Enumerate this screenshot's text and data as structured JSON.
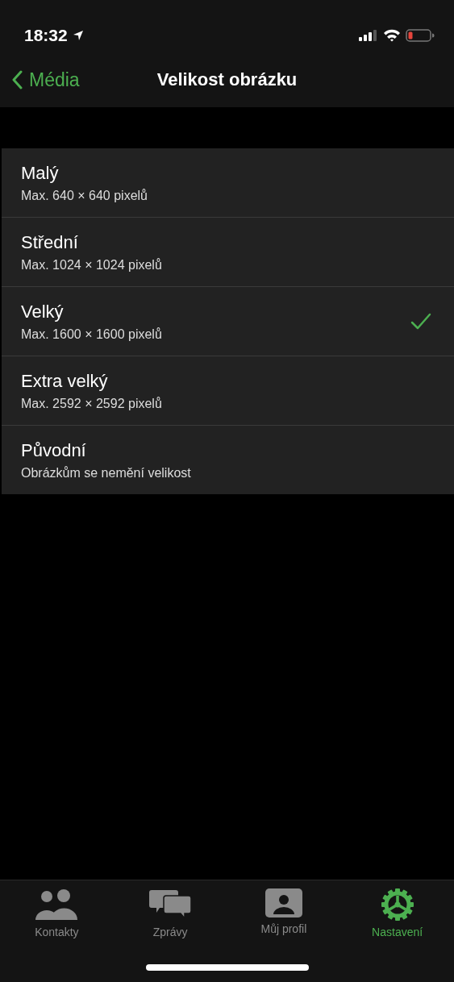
{
  "status_bar": {
    "time": "18:32"
  },
  "nav": {
    "back": "Média",
    "title": "Velikost obrázku"
  },
  "options": [
    {
      "title": "Malý",
      "subtitle": "Max. 640 × 640 pixelů",
      "selected": false
    },
    {
      "title": "Střední",
      "subtitle": "Max. 1024 × 1024 pixelů",
      "selected": false
    },
    {
      "title": "Velký",
      "subtitle": "Max. 1600 × 1600 pixelů",
      "selected": true
    },
    {
      "title": "Extra velký",
      "subtitle": "Max. 2592 × 2592 pixelů",
      "selected": false
    },
    {
      "title": "Původní",
      "subtitle": "Obrázkům se nemění velikost",
      "selected": false
    }
  ],
  "tabs": [
    {
      "label": "Kontakty",
      "kind": "contacts",
      "selected": false
    },
    {
      "label": "Zprávy",
      "kind": "messages",
      "selected": false
    },
    {
      "label": "Můj profil",
      "kind": "profile",
      "selected": false
    },
    {
      "label": "Nastavení",
      "kind": "settings",
      "selected": true
    }
  ]
}
